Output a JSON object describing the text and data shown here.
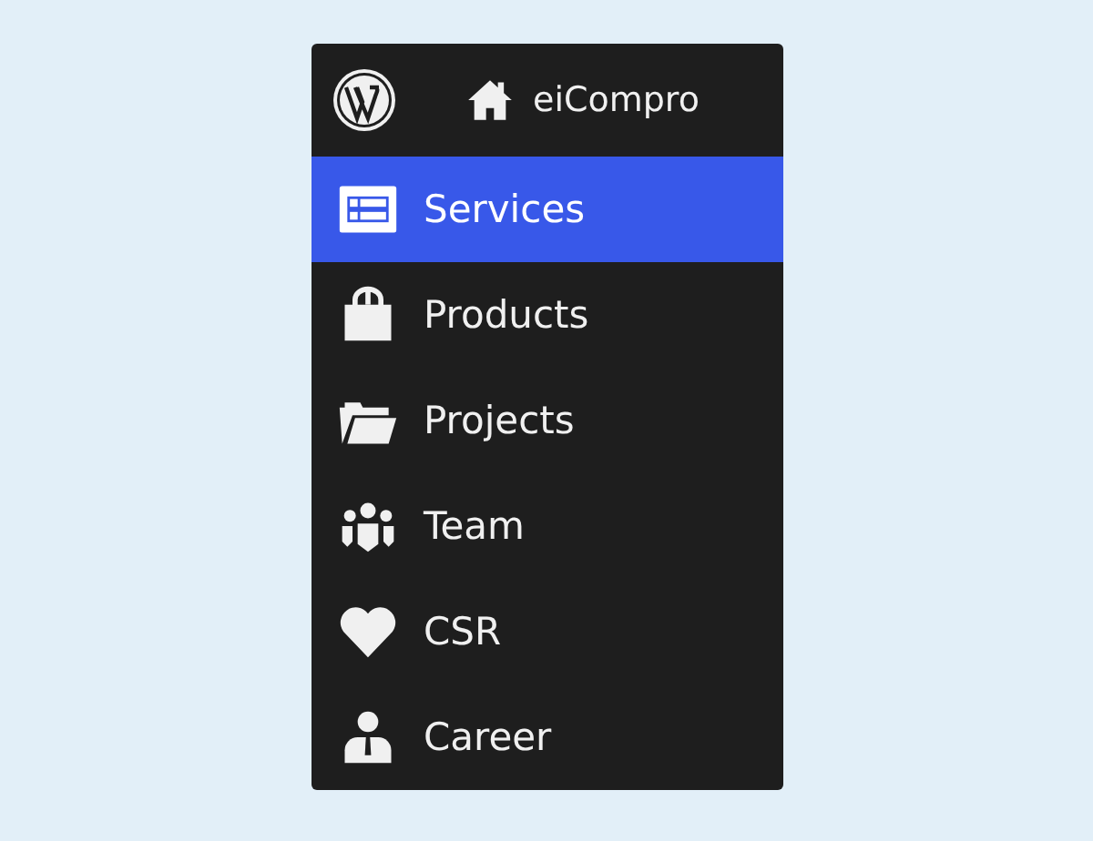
{
  "header": {
    "title": "eiCompro"
  },
  "menu": [
    {
      "label": "Services",
      "kind": "list",
      "selected": true
    },
    {
      "label": "Products",
      "kind": "bag",
      "selected": false
    },
    {
      "label": "Projects",
      "kind": "folder",
      "selected": false
    },
    {
      "label": "Team",
      "kind": "group",
      "selected": false
    },
    {
      "label": "CSR",
      "kind": "heart",
      "selected": false
    },
    {
      "label": "Career",
      "kind": "person",
      "selected": false
    }
  ]
}
